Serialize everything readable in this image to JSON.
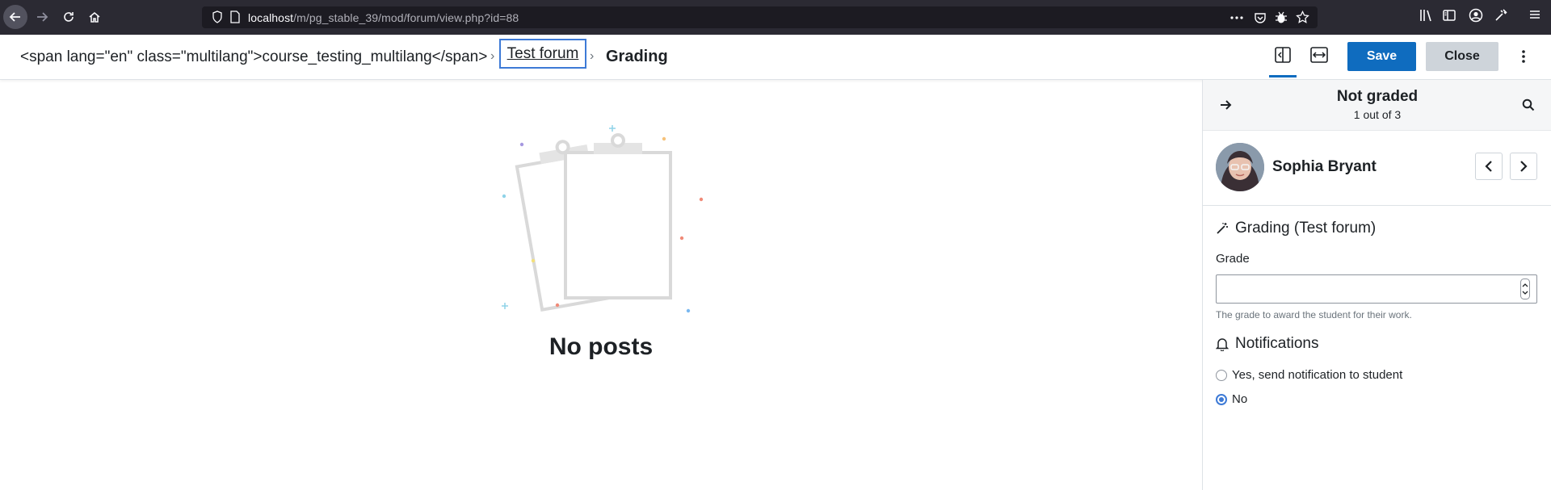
{
  "browser": {
    "url_host": "localhost",
    "url_path": "/m/pg_stable_39/mod/forum/view.php?id=88"
  },
  "header": {
    "breadcrumb_course": "<span lang=\"en\" class=\"multilang\">course_testing_multilang</span>",
    "breadcrumb_forum": "Test forum",
    "breadcrumb_current": "Grading",
    "save_label": "Save",
    "close_label": "Close"
  },
  "main": {
    "empty_title": "No posts"
  },
  "panel": {
    "status_title": "Not graded",
    "status_count": "1 out of 3",
    "user_name": "Sophia Bryant",
    "grading_title": "Grading (Test forum)",
    "grade_label": "Grade",
    "grade_value": "",
    "grade_help": "The grade to award the student for their work.",
    "notifications_title": "Notifications",
    "radio_yes": "Yes, send notification to student",
    "radio_no": "No",
    "selected_option": "No"
  },
  "colors": {
    "primary": "#0f6cbf",
    "browser_chrome": "#2b2a33",
    "focus_ring": "#3d7ad6"
  }
}
